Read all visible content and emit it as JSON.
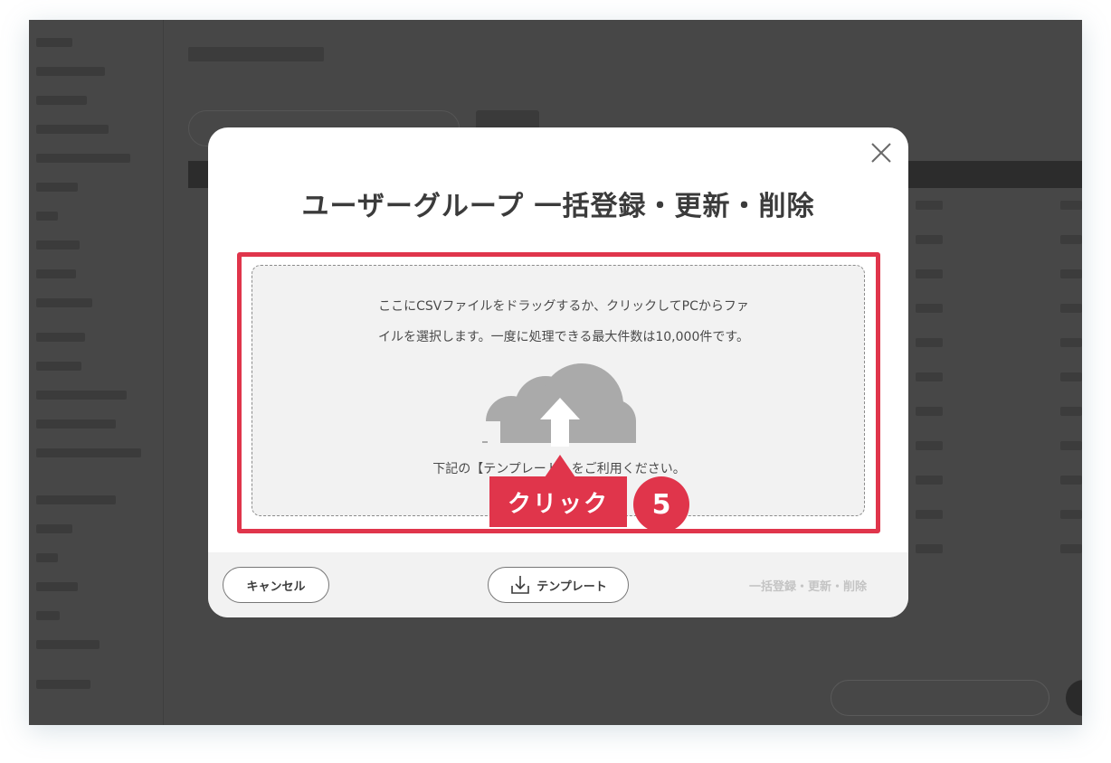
{
  "modal": {
    "title": "ユーザーグループ 一括登録・更新・削除",
    "close_icon": "close-icon",
    "dropzone": {
      "text_line1": "ここにCSVファイルをドラッグするか、クリックしてPCからファ",
      "text_line2": "イルを選択します。一度に処理できる最大件数は10,000件です。",
      "icon": "cloud-upload-icon",
      "note": "下記の【テンプレート】をご利用ください。"
    },
    "footer": {
      "cancel_label": "キャンセル",
      "template_label": "テンプレート",
      "template_icon": "download-icon",
      "submit_label": "一括登録・更新・削除"
    }
  },
  "annotation": {
    "callout_label": "クリック",
    "step_number": "5",
    "color": "#e0354b"
  }
}
